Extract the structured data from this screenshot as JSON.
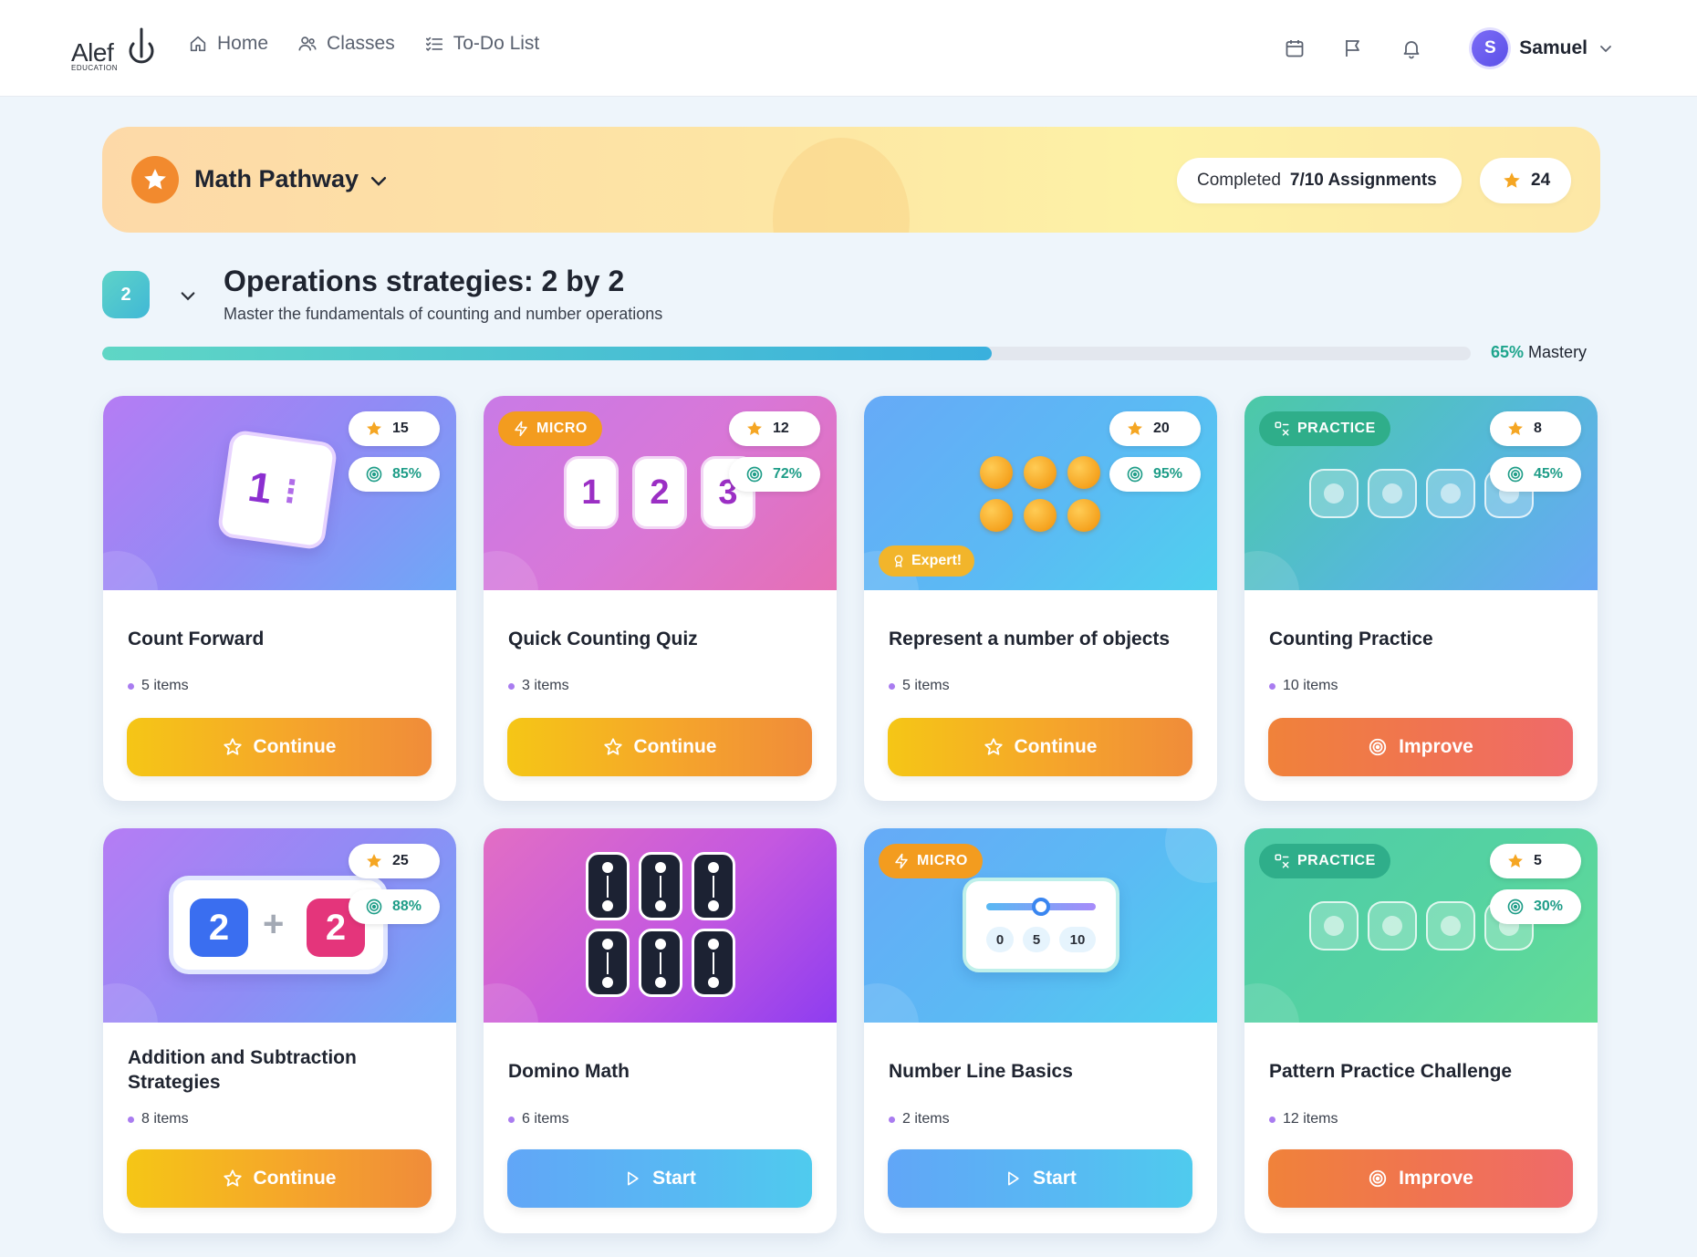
{
  "nav": {
    "logo_text": "Alef",
    "logo_sub": "EDUCATION",
    "links": [
      {
        "label": "Home",
        "icon": "home-icon"
      },
      {
        "label": "Classes",
        "icon": "users-icon"
      },
      {
        "label": "To-Do List",
        "icon": "checklist-icon"
      }
    ],
    "right_icons": [
      "calendar-icon",
      "flag-icon",
      "bell-icon"
    ],
    "user": {
      "initial": "S",
      "name": "Samuel"
    }
  },
  "pathway": {
    "title": "Math Pathway",
    "completed_label": "Completed",
    "completed_value": "7/10 Assignments",
    "stars": "24"
  },
  "section": {
    "level": "2",
    "title": "Operations strategies: 2 by 2",
    "subtitle": "Master the fundamentals of counting and number operations",
    "mastery_pct": "65%",
    "mastery_label": "Mastery",
    "mastery_value": 0.65
  },
  "cards": [
    {
      "title": "Count Forward",
      "items": "5 items",
      "stars": "15",
      "accuracy": "85%",
      "button": "Continue"
    },
    {
      "tag": "MICRO",
      "title": "Quick Counting Quiz",
      "items": "3 items",
      "stars": "12",
      "accuracy": "72%",
      "button": "Continue",
      "tiles": [
        "1",
        "2",
        "3"
      ]
    },
    {
      "badge": "Expert!",
      "title": "Represent a number of objects",
      "items": "5 items",
      "stars": "20",
      "accuracy": "95%",
      "button": "Continue"
    },
    {
      "tag": "PRACTICE",
      "title": "Counting Practice",
      "items": "10 items",
      "stars": "8",
      "accuracy": "45%",
      "button": "Improve"
    },
    {
      "title": "Addition and Subtraction Strategies",
      "items": "8 items",
      "stars": "25",
      "accuracy": "88%",
      "button": "Continue",
      "equation": [
        "2",
        "+",
        "2"
      ]
    },
    {
      "title": "Domino Math",
      "items": "6 items",
      "button": "Start"
    },
    {
      "tag": "MICRO",
      "title": "Number Line Basics",
      "items": "2 items",
      "button": "Start",
      "numberline": [
        "0",
        "5",
        "10"
      ]
    },
    {
      "tag": "PRACTICE",
      "title": "Pattern Practice Challenge",
      "items": "12 items",
      "stars": "5",
      "accuracy": "30%",
      "button": "Improve"
    }
  ],
  "colors": {
    "accent_teal": "#40b8d6",
    "star": "#f5a623",
    "continue": "#f5b323",
    "improve": "#f07352",
    "start": "#58b8f3"
  }
}
